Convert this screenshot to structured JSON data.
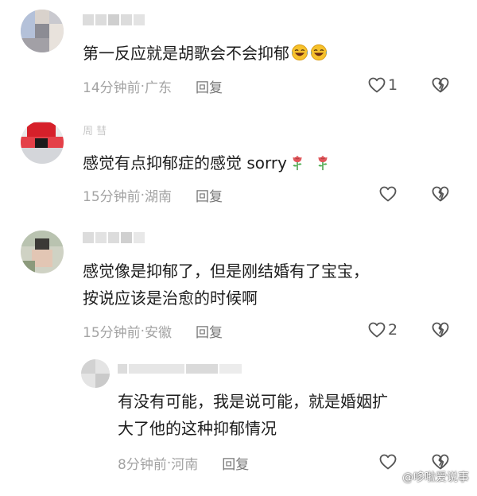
{
  "comments": [
    {
      "text_lines": [
        "第一反应就是胡歌会不会抑郁"
      ],
      "emojis": [
        "laughing-crying-emoji",
        "laughing-crying-emoji"
      ],
      "time": "14分钟前",
      "location": "广东",
      "reply_label": "回复",
      "likes": "1"
    },
    {
      "username": "周 彗",
      "text_lines": [
        "感觉有点抑郁症的感觉  sorry"
      ],
      "emojis": [
        "rose-emoji",
        "rose-emoji"
      ],
      "time": "15分钟前",
      "location": "湖南",
      "reply_label": "回复",
      "likes": ""
    },
    {
      "text_lines": [
        "感觉像是抑郁了，但是刚结婚有了宝宝，",
        "按说应该是治愈的时候啊"
      ],
      "time": "15分钟前",
      "location": "安徽",
      "reply_label": "回复",
      "likes": "2"
    },
    {
      "text_lines": [
        "有没有可能，我是说可能，就是婚姻扩",
        "大了他的这种抑郁情况"
      ],
      "time": "8分钟前",
      "location": "河南",
      "reply_label": "回复",
      "likes": ""
    }
  ],
  "separator": " · ",
  "watermark": "@哆啦爱说事",
  "colors": {
    "meta": "#a3a3a3",
    "body": "#1c1c1c",
    "rose": "#e0575b"
  }
}
